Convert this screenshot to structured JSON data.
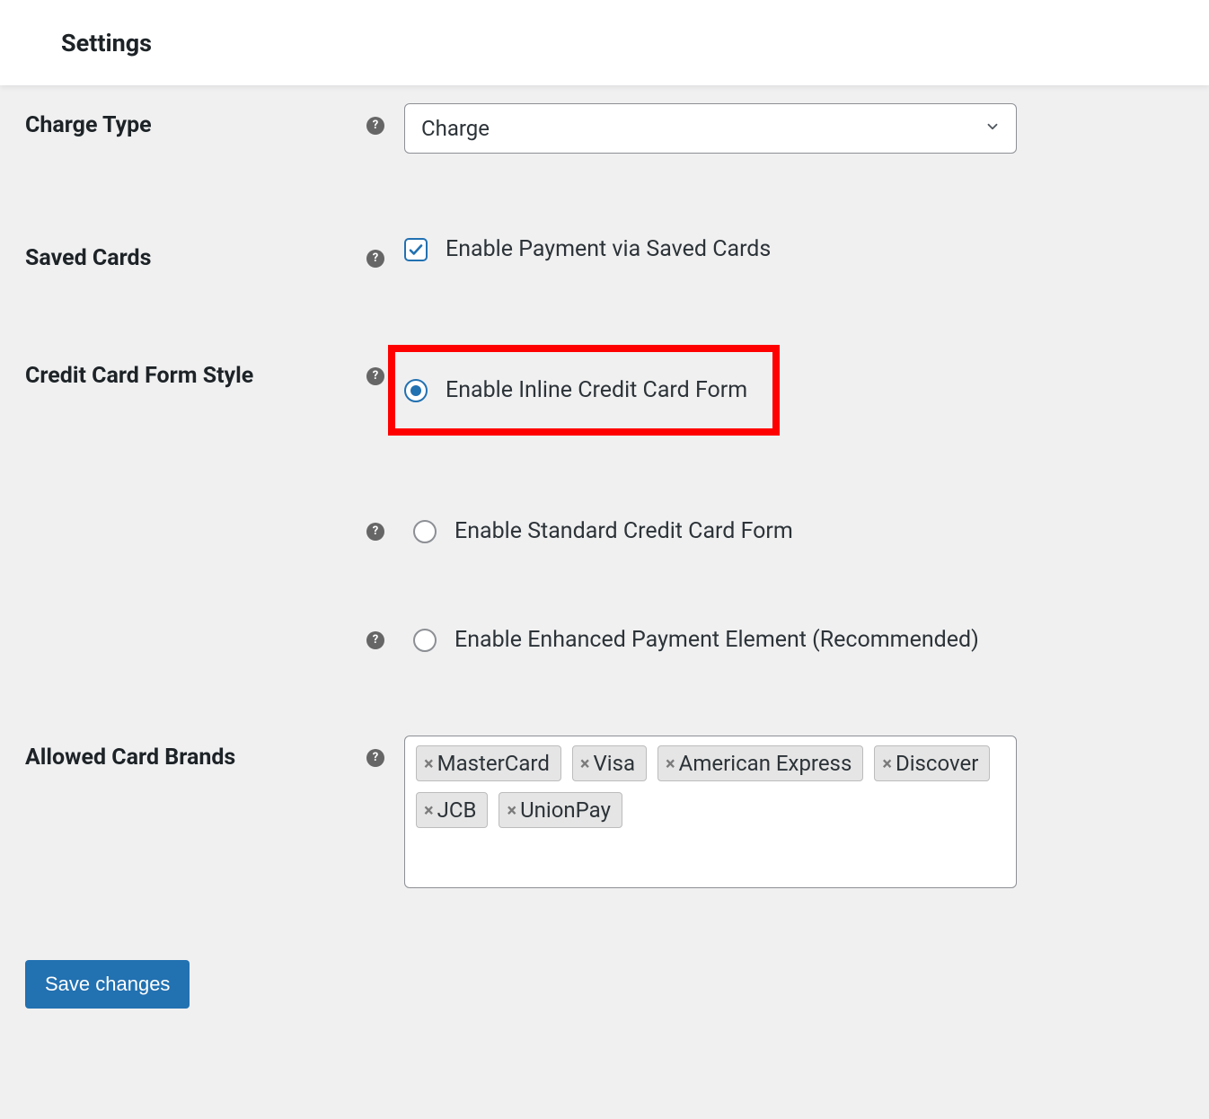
{
  "header": {
    "title": "Settings"
  },
  "rows": {
    "charge_type": {
      "label": "Charge Type",
      "selected": "Charge"
    },
    "saved_cards": {
      "label": "Saved Cards",
      "option": "Enable Payment via Saved Cards",
      "checked": true
    },
    "cc_form_style": {
      "label": "Credit Card Form Style",
      "inline": "Enable Inline Credit Card Form",
      "standard": "Enable Standard Credit Card Form",
      "enhanced": "Enable Enhanced Payment Element (Recommended)",
      "selected": "inline"
    },
    "allowed_brands": {
      "label": "Allowed Card Brands",
      "tags": [
        "MasterCard",
        "Visa",
        "American Express",
        "Discover",
        "JCB",
        "UnionPay"
      ]
    }
  },
  "buttons": {
    "save": "Save changes"
  },
  "highlight": {
    "target": "cc_form_style_inline",
    "color": "#ff0000"
  }
}
